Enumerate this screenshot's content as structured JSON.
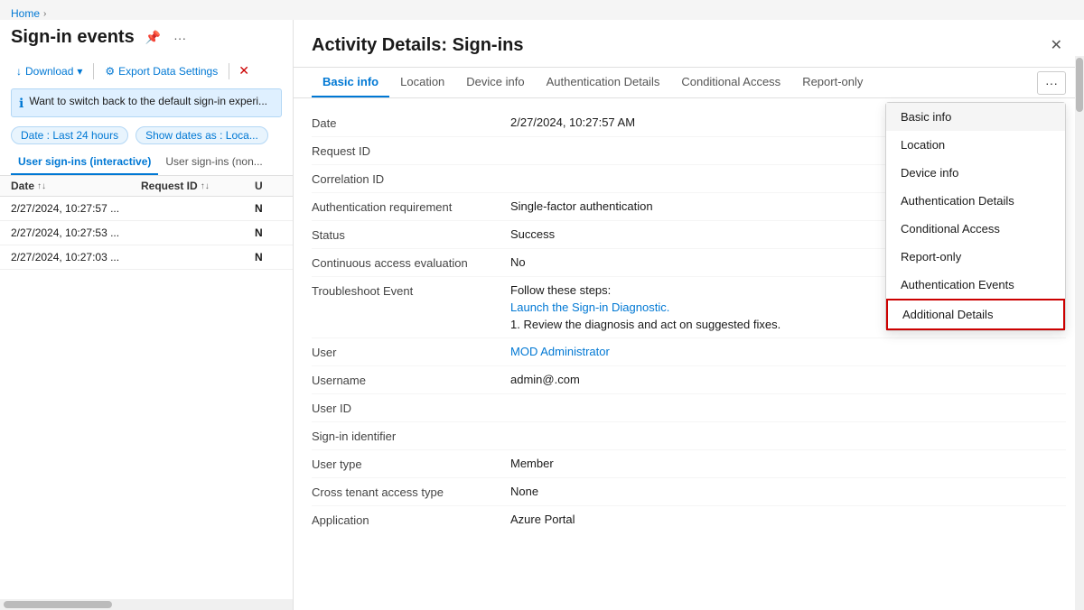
{
  "breadcrumb": {
    "home": "Home",
    "separator": "›"
  },
  "left_panel": {
    "title": "Sign-in events",
    "toolbar": {
      "download": "Download",
      "export": "Export Data Settings",
      "filter_icon": "⚙"
    },
    "info_banner": "Want to switch back to the default sign-in experi...",
    "filters": {
      "date_filter": "Date : Last 24 hours",
      "date_display": "Show dates as : Loca..."
    },
    "tabs": [
      {
        "id": "interactive",
        "label": "User sign-ins (interactive)",
        "active": true
      },
      {
        "id": "non-interactive",
        "label": "User sign-ins (non...",
        "active": false
      }
    ],
    "table": {
      "columns": [
        {
          "id": "date",
          "label": "Date"
        },
        {
          "id": "requestid",
          "label": "Request ID"
        },
        {
          "id": "extra",
          "label": "U"
        }
      ],
      "rows": [
        {
          "date": "2/27/2024, 10:27:57 ...",
          "requestid": "",
          "extra": "N"
        },
        {
          "date": "2/27/2024, 10:27:53 ...",
          "requestid": "",
          "extra": "N"
        },
        {
          "date": "2/27/2024, 10:27:03 ...",
          "requestid": "",
          "extra": "N"
        }
      ]
    }
  },
  "detail_panel": {
    "title": "Activity Details: Sign-ins",
    "tabs": [
      {
        "id": "basic-info",
        "label": "Basic info",
        "active": true
      },
      {
        "id": "location",
        "label": "Location",
        "active": false
      },
      {
        "id": "device-info",
        "label": "Device info",
        "active": false
      },
      {
        "id": "auth-details",
        "label": "Authentication Details",
        "active": false
      },
      {
        "id": "conditional-access",
        "label": "Conditional Access",
        "active": false
      },
      {
        "id": "report-only",
        "label": "Report-only",
        "active": false
      }
    ],
    "more_icon": "···",
    "dropdown": {
      "items": [
        {
          "id": "basic-info",
          "label": "Basic info",
          "active": true
        },
        {
          "id": "location",
          "label": "Location",
          "active": false
        },
        {
          "id": "device-info",
          "label": "Device info",
          "active": false
        },
        {
          "id": "auth-details",
          "label": "Authentication Details",
          "active": false
        },
        {
          "id": "conditional-access",
          "label": "Conditional Access",
          "active": false
        },
        {
          "id": "report-only",
          "label": "Report-only",
          "active": false
        },
        {
          "id": "auth-events",
          "label": "Authentication Events",
          "active": false
        },
        {
          "id": "additional-details",
          "label": "Additional Details",
          "highlighted": true,
          "active": false
        }
      ]
    },
    "fields": [
      {
        "id": "date",
        "label": "Date",
        "value": "2/27/2024, 10:27:57 AM",
        "type": "text"
      },
      {
        "id": "request-id",
        "label": "Request ID",
        "value": "",
        "type": "text"
      },
      {
        "id": "correlation-id",
        "label": "Correlation ID",
        "value": "",
        "type": "text"
      },
      {
        "id": "auth-requirement",
        "label": "Authentication requirement",
        "value": "Single-factor authentication",
        "type": "text"
      },
      {
        "id": "status",
        "label": "Status",
        "value": "Success",
        "type": "text"
      },
      {
        "id": "continuous-access",
        "label": "Continuous access evaluation",
        "value": "No",
        "type": "text"
      },
      {
        "id": "troubleshoot",
        "label": "Troubleshoot Event",
        "value": "",
        "type": "troubleshoot"
      },
      {
        "id": "user",
        "label": "User",
        "value": "MOD Administrator",
        "type": "link"
      },
      {
        "id": "username",
        "label": "Username",
        "value": "admin@.com",
        "type": "text"
      },
      {
        "id": "user-id",
        "label": "User ID",
        "value": "",
        "type": "text"
      },
      {
        "id": "signin-identifier",
        "label": "Sign-in identifier",
        "value": "",
        "type": "text"
      },
      {
        "id": "user-type",
        "label": "User type",
        "value": "Member",
        "type": "text"
      },
      {
        "id": "cross-tenant",
        "label": "Cross tenant access type",
        "value": "None",
        "type": "text"
      },
      {
        "id": "application",
        "label": "Application",
        "value": "Azure Portal",
        "type": "text"
      }
    ],
    "troubleshoot": {
      "follow_steps": "Follow these steps:",
      "link_text": "Launch the Sign-in Diagnostic.",
      "step1": "1. Review the diagnosis and act on suggested fixes."
    }
  }
}
